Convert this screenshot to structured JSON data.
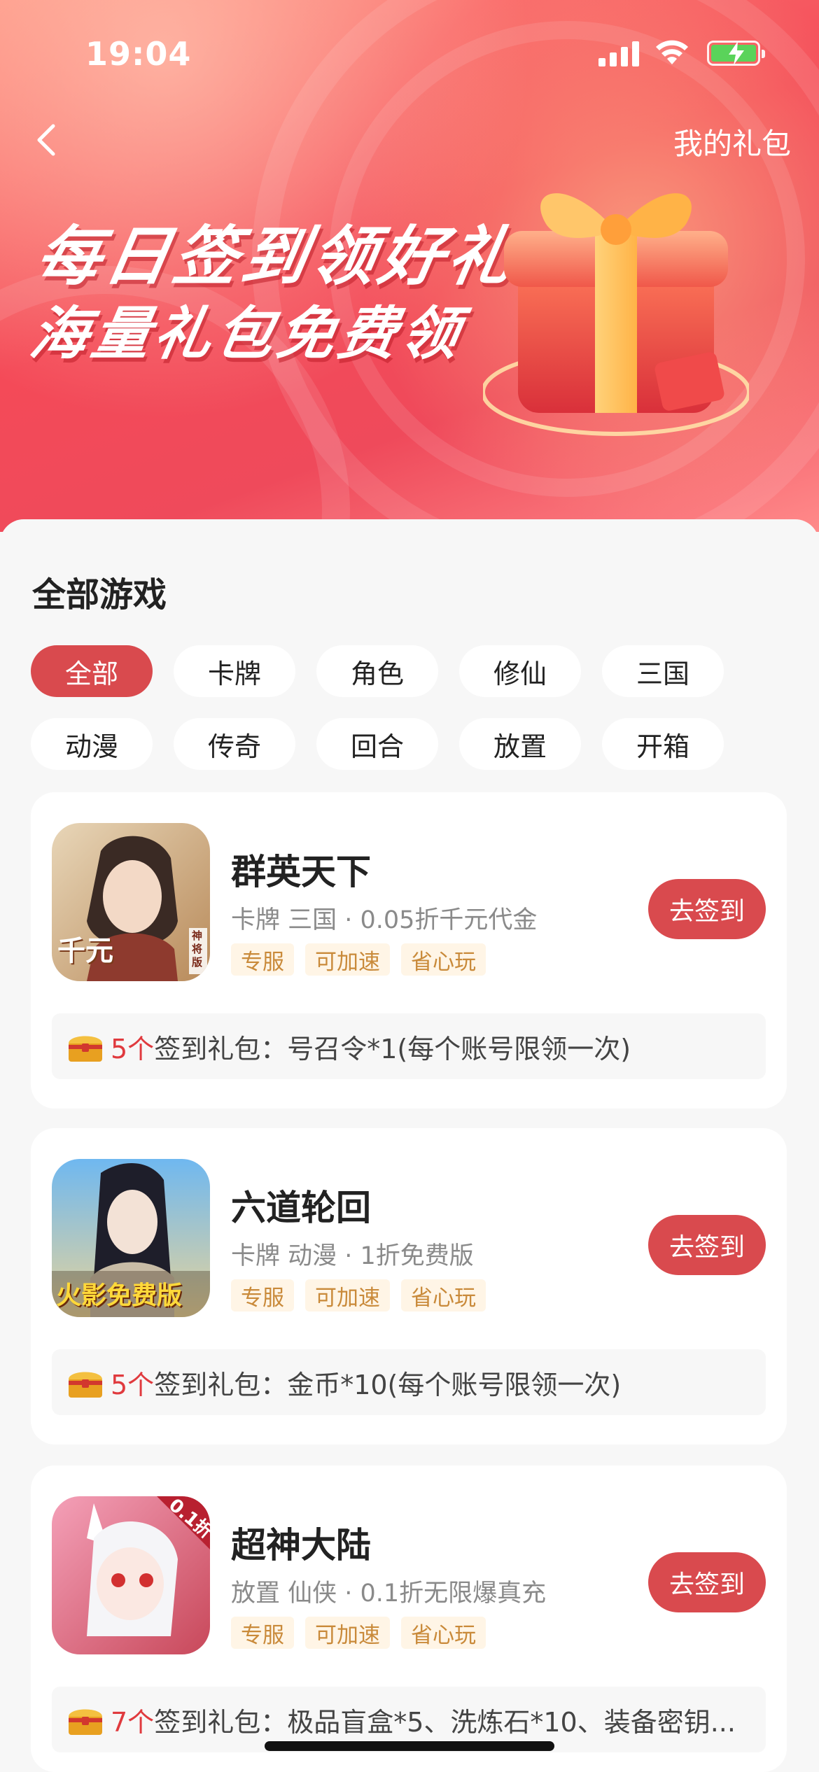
{
  "status_bar": {
    "time": "19:04"
  },
  "header": {
    "my_gifts": "我的礼包"
  },
  "banner": {
    "line1": "每日签到领好礼",
    "line2": "海量礼包免费领"
  },
  "section": {
    "title": "全部游戏"
  },
  "filters": {
    "chips": [
      "全部",
      "卡牌",
      "角色",
      "修仙",
      "三国",
      "动漫",
      "传奇",
      "回合",
      "放置",
      "开箱"
    ],
    "active": "全部"
  },
  "games": [
    {
      "name": "群英天下",
      "meta": "卡牌 三国 · 0.05折千元代金",
      "tags": [
        "专服",
        "可加速",
        "省心玩"
      ],
      "button": "去签到",
      "gift_count": "5个",
      "gift_text": "签到礼包：号召令*1(每个账号限领一次)",
      "icon_badge": "千元",
      "icon_side_badge": "神将版"
    },
    {
      "name": "六道轮回",
      "meta": "卡牌 动漫 · 1折免费版",
      "tags": [
        "专服",
        "可加速",
        "省心玩"
      ],
      "button": "去签到",
      "gift_count": "5个",
      "gift_text": "签到礼包：金币*10(每个账号限领一次)",
      "icon_badge": "火影免费版"
    },
    {
      "name": "超神大陆",
      "meta": "放置 仙侠 · 0.1折无限爆真充",
      "tags": [
        "专服",
        "可加速",
        "省心玩"
      ],
      "button": "去签到",
      "gift_count": "7个",
      "gift_text": "签到礼包：极品盲盒*5、洗炼石*10、装备密钥...",
      "icon_badge": "0.1折"
    }
  ],
  "colors": {
    "accent": "#d94a4e",
    "tag_text": "#c98a3a",
    "tag_bg": "#fff5e6",
    "gift_count": "#e03a3e"
  }
}
